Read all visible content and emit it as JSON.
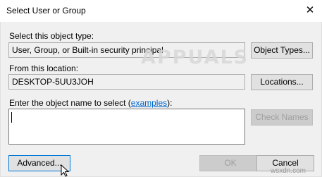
{
  "window": {
    "title": "Select User or Group"
  },
  "object_type": {
    "label": "Select this object type:",
    "value": "User, Group, or Built-in security principal",
    "button": "Object Types..."
  },
  "location": {
    "label": "From this location:",
    "value": "DESKTOP-5UU3JOH",
    "button": "Locations..."
  },
  "object_name": {
    "label_prefix": "Enter the object name to select (",
    "link": "examples",
    "label_suffix": "):",
    "value": "",
    "check_button": "Check Names"
  },
  "buttons": {
    "advanced": "Advanced...",
    "ok": "OK",
    "cancel": "Cancel"
  },
  "watermark": "APPUALS",
  "footer": "wsxdn.com",
  "icons": {
    "close": "close-icon",
    "cursor": "mouse-cursor-icon"
  }
}
